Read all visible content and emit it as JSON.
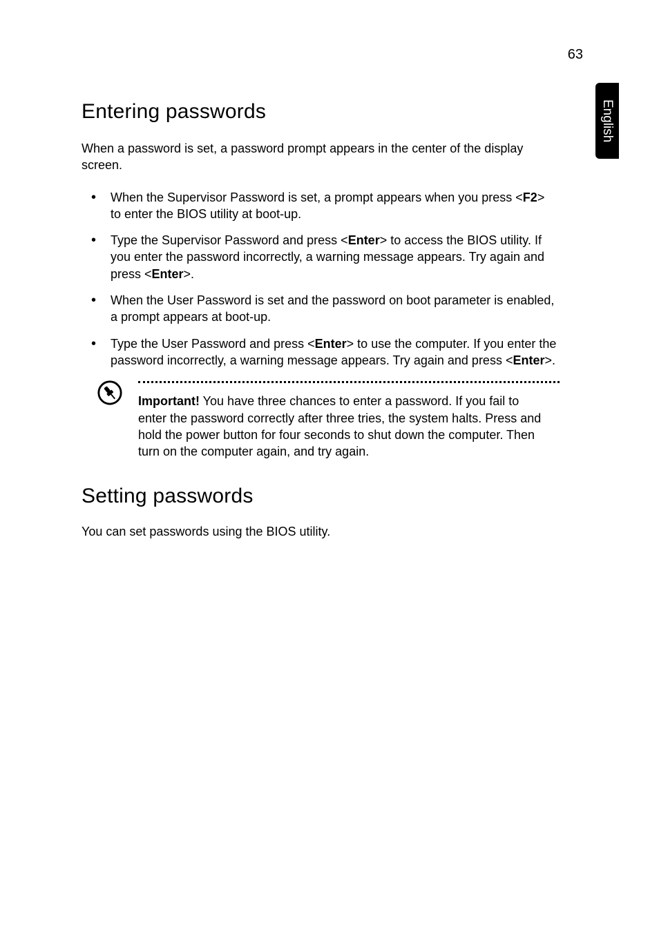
{
  "page_number": "63",
  "language_tab": "English",
  "section1": {
    "heading": "Entering passwords",
    "intro": "When a password is set, a password prompt appears in the center of the display screen.",
    "bullets": [
      {
        "pre": "When the Supervisor Password is set, a prompt appears when you press <",
        "k1": "F2",
        "post1": "> to enter the BIOS utility at boot-up."
      },
      {
        "pre": "Type the Supervisor Password and press <",
        "k1": "Enter",
        "mid1": "> to access the BIOS utility. If you enter the password incorrectly, a warning message appears. Try again and press <",
        "k2": "Enter",
        "post2": ">."
      },
      {
        "pre": "When the User Password is set and the password on boot parameter is enabled, a prompt appears at boot-up."
      },
      {
        "pre": "Type the User Password and press <",
        "k1": "Enter",
        "mid1": "> to use the computer. If you enter the password incorrectly, a warning message appears. Try again and press <",
        "k2": "Enter",
        "post2": ">."
      }
    ],
    "note": {
      "label": "Important!",
      "text": " You have three chances to enter a password. If you fail to enter the password correctly after three tries, the system halts. Press and hold the power button for four seconds to shut down the computer. Then turn on the computer again, and try again."
    }
  },
  "section2": {
    "heading": "Setting passwords",
    "body": "You can set passwords using the BIOS utility."
  }
}
